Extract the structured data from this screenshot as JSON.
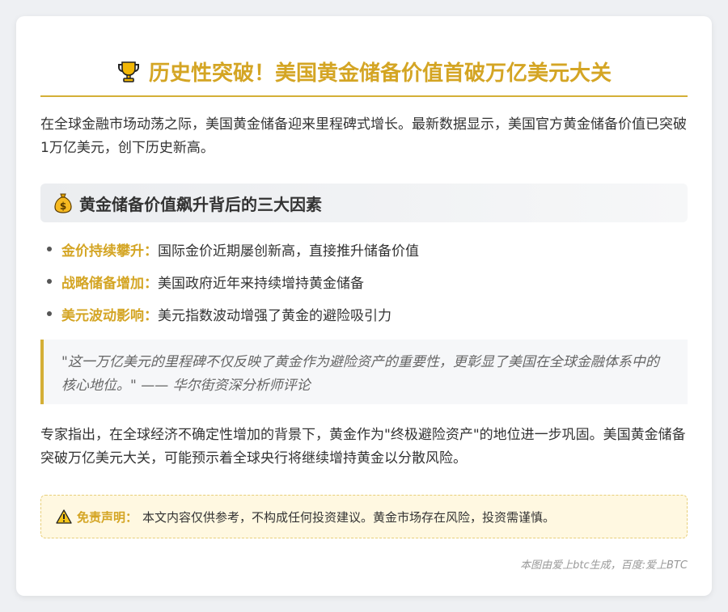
{
  "title": "历史性突破！美国黄金储备价值首破万亿美元大关",
  "intro": "在全球金融市场动荡之际，美国黄金储备迎来里程碑式增长。最新数据显示，美国官方黄金储备价值已突破1万亿美元，创下历史新高。",
  "section": {
    "heading": "黄金储备价值飙升背后的三大因素",
    "icon": "money-bag-icon",
    "items": [
      {
        "key": "金价持续攀升：",
        "text": "国际金价近期屡创新高，直接推升储备价值"
      },
      {
        "key": "战略储备增加：",
        "text": "美国政府近年来持续增持黄金储备"
      },
      {
        "key": "美元波动影响：",
        "text": "美元指数波动增强了黄金的避险吸引力"
      }
    ]
  },
  "quote": "\"这一万亿美元的里程碑不仅反映了黄金作为避险资产的重要性，更彰显了美国在全球金融体系中的核心地位。\" —— 华尔街资深分析师评论",
  "expert": "专家指出，在全球经济不确定性增加的背景下，黄金作为\"终极避险资产\"的地位进一步巩固。美国黄金储备突破万亿美元大关，可能预示着全球央行将继续增持黄金以分散风险。",
  "notice": {
    "icon": "warning-icon",
    "key": "免责声明：",
    "text": "本文内容仅供参考，不构成任何投资建议。黄金市场存在风险，投资需谨慎。"
  },
  "footer": "本图由爱上btc生成，百度:爱上BTC",
  "colors": {
    "accent": "#d4a524",
    "border": "#d4af37",
    "notice_bg": "#fff8e1"
  }
}
